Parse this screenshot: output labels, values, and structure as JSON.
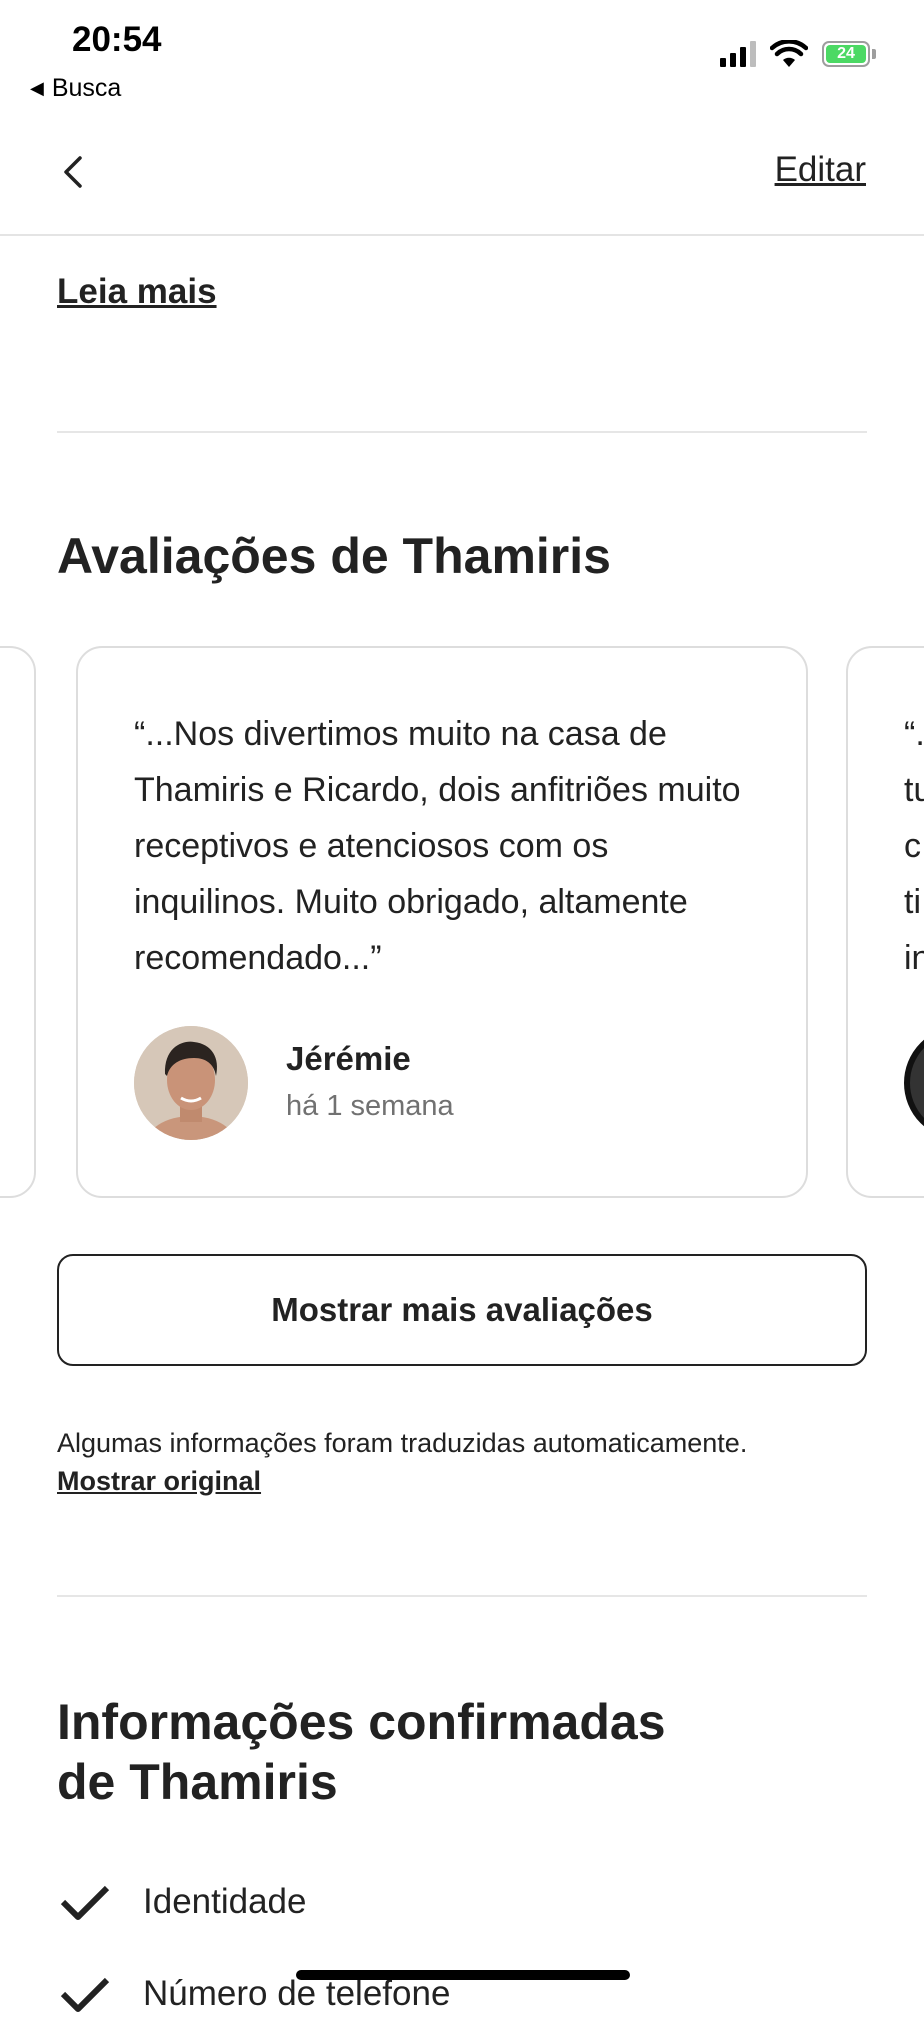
{
  "status_bar": {
    "time": "20:54",
    "back_app": "Busca",
    "battery": "24"
  },
  "nav": {
    "edit_label": "Editar"
  },
  "about": {
    "read_more": "Leia mais"
  },
  "reviews": {
    "title": "Avaliações de Thamiris",
    "cards": [
      {
        "quote": "“...Nos divertimos muito na casa de Thamiris e Ricardo, dois anfitriões muito receptivos e atenciosos com os inquilinos. Muito obrigado, altamente recomendado...”",
        "name": "Jérémie",
        "date": "há 1 semana"
      }
    ],
    "next_card_peek": "“.\ntu\nc\nti\nin",
    "show_more": "Mostrar mais avaliações",
    "translation_note": "Algumas informações foram traduzidas automaticamente.",
    "show_original": "Mostrar original"
  },
  "confirmed": {
    "title_line1": "Informações confirmadas",
    "title_line2": "de Thamiris",
    "items": [
      "Identidade",
      "Número de telefone"
    ]
  }
}
